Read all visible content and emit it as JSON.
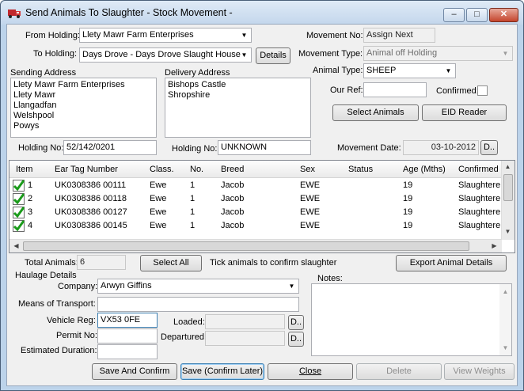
{
  "window": {
    "title": "Send Animals To Slaughter - Stock Movement -",
    "min": "–",
    "max": "□",
    "close": "✕"
  },
  "from_holding": {
    "label": "From Holding:",
    "value": "Llety Mawr Farm Enterprises"
  },
  "to_holding": {
    "label": "To Holding:",
    "value": "Days Drove - Days Drove Slaught House",
    "details_button": "Details"
  },
  "sending_address": {
    "label": "Sending Address",
    "lines": [
      "Llety Mawr Farm Enterprises",
      "Llety Mawr",
      "Llangadfan",
      "Welshpool",
      "Powys"
    ]
  },
  "delivery_address": {
    "label": "Delivery Address",
    "lines": [
      "Bishops Castle",
      "Shropshire"
    ]
  },
  "movement_no": {
    "label": "Movement No:",
    "value": "Assign Next"
  },
  "movement_type": {
    "label": "Movement Type:",
    "value": "Animal off Holding"
  },
  "animal_type": {
    "label": "Animal Type:",
    "value": "SHEEP"
  },
  "our_ref": {
    "label": "Our Ref:",
    "value": ""
  },
  "confirmed": {
    "label": "Confirmed:",
    "checked": false
  },
  "select_animals_button": "Select Animals",
  "eid_reader_button": "EID Reader",
  "sending_holding_no": {
    "label": "Holding No:",
    "value": "52/142/0201"
  },
  "delivery_holding_no": {
    "label": "Holding No:",
    "value": "UNKNOWN"
  },
  "movement_date": {
    "label": "Movement Date:",
    "value": "03-10-2012",
    "button": "D.."
  },
  "grid": {
    "columns": [
      "Item",
      "Ear Tag Number",
      "Class.",
      "No.",
      "Breed",
      "Sex",
      "Status",
      "Age (Mths)",
      "Confirmed"
    ],
    "rows": [
      {
        "item": "1",
        "tag": "UK0308386 00111",
        "class": "Ewe",
        "no": "1",
        "breed": "Jacob",
        "sex": "EWE",
        "status": "",
        "age": "19",
        "confirmed": "Slaughtere"
      },
      {
        "item": "2",
        "tag": "UK0308386 00118",
        "class": "Ewe",
        "no": "1",
        "breed": "Jacob",
        "sex": "EWE",
        "status": "",
        "age": "19",
        "confirmed": "Slaughtere"
      },
      {
        "item": "3",
        "tag": "UK0308386 00127",
        "class": "Ewe",
        "no": "1",
        "breed": "Jacob",
        "sex": "EWE",
        "status": "",
        "age": "19",
        "confirmed": "Slaughtere"
      },
      {
        "item": "4",
        "tag": "UK0308386 00145",
        "class": "Ewe",
        "no": "1",
        "breed": "Jacob",
        "sex": "EWE",
        "status": "",
        "age": "19",
        "confirmed": "Slaughtere"
      }
    ]
  },
  "total_animals": {
    "label": "Total Animals:",
    "value": "6"
  },
  "select_all_button": "Select All",
  "tick_hint": "Tick animals to confirm slaughter",
  "export_button": "Export Animal Details",
  "haulage": {
    "title": "Haulage Details",
    "company": {
      "label": "Company:",
      "value": "Arwyn Giffins"
    },
    "means": {
      "label": "Means of Transport:",
      "value": ""
    },
    "vehicle_reg": {
      "label": "Vehicle Reg:",
      "value": "VX53 0FE"
    },
    "permit_no": {
      "label": "Permit No:",
      "value": ""
    },
    "duration": {
      "label": "Estimated Duration:",
      "value": ""
    },
    "loaded": {
      "label": "Loaded:",
      "value": "",
      "button": "D.."
    },
    "departured": {
      "label": "Departured:",
      "value": "",
      "button": "D.."
    }
  },
  "notes": {
    "label": "Notes:",
    "value": ""
  },
  "footer": {
    "save_confirm": "Save And Confirm",
    "save_later": "Save (Confirm Later)",
    "close": "Close",
    "delete": "Delete",
    "view_weights": "View Weights"
  }
}
